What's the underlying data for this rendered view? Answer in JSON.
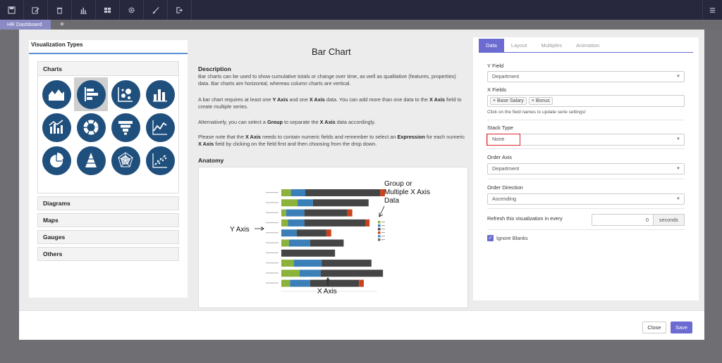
{
  "topbar": {
    "icons": [
      "save-icon",
      "edit-icon",
      "trash-icon",
      "bar-chart-icon",
      "dashboard-icon",
      "gear-icon",
      "brush-icon",
      "export-icon"
    ],
    "right_icon": "menu-icon"
  },
  "tabs": {
    "active": "HR Dashboard",
    "add": "+"
  },
  "left": {
    "title": "Visualization Types",
    "charts_header": "Charts",
    "sections": [
      "Diagrams",
      "Maps",
      "Gauges",
      "Others"
    ]
  },
  "main": {
    "title": "Bar Chart",
    "description_heading": "Description",
    "p1": "Bar charts can be used to show cumulative totals or change over time, as well as qualitative (features, properties) data. Bar charts are horizontal, whereas column charts are vertical.",
    "p2_a": "A bar chart requires at least one ",
    "p2_b": "Y Axis",
    "p2_c": " and one ",
    "p2_d": "X Axis",
    "p2_e": " data. You can add more than one data to the ",
    "p2_f": "X Axis",
    "p2_g": " field to create multiple series.",
    "p3_a": "Alternatively, you can select a ",
    "p3_b": "Group",
    "p3_c": " to separate the ",
    "p3_d": "X Axis",
    "p3_e": " data accordingly.",
    "p4_a": "Please note that the ",
    "p4_b": "X Axis",
    "p4_c": " needs to contain numeric fields and remember to select an ",
    "p4_d": "Expression",
    "p4_e": " for each numeric ",
    "p4_f": "X Axis",
    "p4_g": " field by clicking on the field first and then choosing from the drop down.",
    "anatomy_heading": "Anatomy",
    "anatomy": {
      "y_axis_label": "Y Axis",
      "x_axis_label": "X Axis",
      "group_label_1": "Group or",
      "group_label_2": "Multiple X Axis",
      "group_label_3": "Data",
      "bars": [
        [
          0.1,
          0.15,
          0.78,
          0.05
        ],
        [
          0.17,
          0.16,
          0.58,
          0.0
        ],
        [
          0.05,
          0.19,
          0.45,
          0.05
        ],
        [
          0.07,
          0.17,
          0.64,
          0.04
        ],
        [
          0.0,
          0.16,
          0.31,
          0.05
        ],
        [
          0.08,
          0.22,
          0.35,
          0.0
        ],
        [
          0.0,
          0.0,
          0.56,
          0.0
        ],
        [
          0.13,
          0.29,
          0.52,
          0.0
        ],
        [
          0.19,
          0.22,
          0.65,
          0.0
        ],
        [
          0.09,
          0.21,
          0.51,
          0.05
        ]
      ],
      "colors": [
        "#8bb23a",
        "#3a7fb8",
        "#454545",
        "#c9421c"
      ]
    }
  },
  "right": {
    "tabs": [
      "Data",
      "Layout",
      "Multiples",
      "Animation"
    ],
    "active_tab": "Data",
    "y_field_label": "Y Field",
    "y_field_value": "Department",
    "x_fields_label": "X Fields",
    "x_fields": [
      "Base Salary",
      "Bonus"
    ],
    "x_hint": "Click on the field names to update serie settings!",
    "stack_type_label": "Stack Type",
    "stack_type_value": "None",
    "order_axis_label": "Order Axis",
    "order_axis_value": "Department",
    "order_dir_label": "Order Direction",
    "order_dir_value": "Ascending",
    "refresh_label": "Refresh this visualization in every",
    "refresh_value": "0",
    "refresh_unit": "seconds",
    "ignore_blanks_label": "Ignore Blanks"
  },
  "footer": {
    "close": "Close",
    "save": "Save"
  }
}
